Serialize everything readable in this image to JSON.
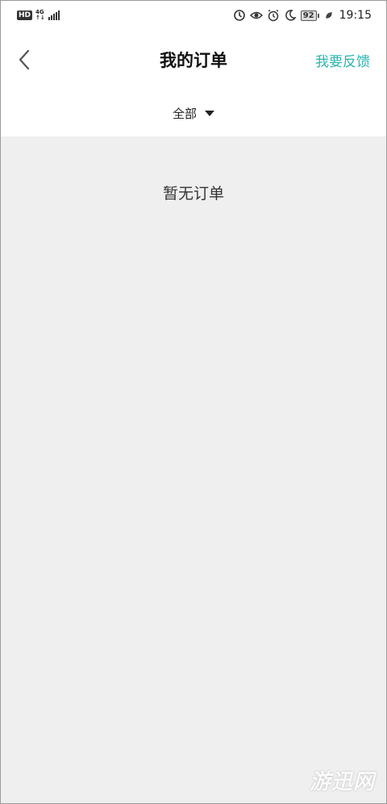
{
  "status_bar": {
    "hd_label": "HD",
    "network_top": "4G",
    "network_bottom": "↑↓",
    "battery_level": "92",
    "time": "19:15",
    "icons": [
      "sync-icon",
      "eye-comfort-icon",
      "alarm-icon",
      "moon-icon",
      "leaf-icon"
    ]
  },
  "nav": {
    "title": "我的订单",
    "feedback_label": "我要反馈",
    "back_icon": "chevron-left-icon"
  },
  "filter": {
    "selected": "全部",
    "dropdown_icon": "caret-down-icon"
  },
  "content": {
    "empty_message": "暂无订单"
  },
  "watermark": {
    "text": "游迅网"
  },
  "colors": {
    "accent": "#2bb5b0",
    "content_bg": "#efefef"
  }
}
